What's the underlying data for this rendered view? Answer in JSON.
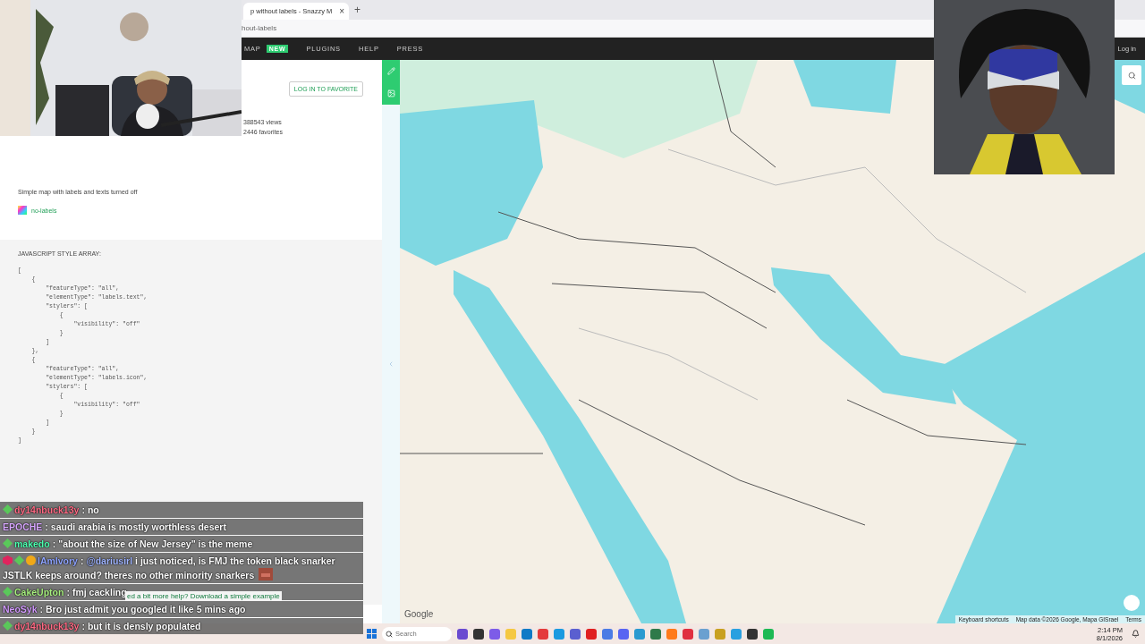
{
  "browser": {
    "tab_title": "p without labels - Snazzy M",
    "tab_close": "×",
    "new_tab": "+",
    "address": "hout-labels"
  },
  "nav": {
    "items": [
      {
        "label": "MAP",
        "badge": "NEW"
      },
      {
        "label": "PLUGINS"
      },
      {
        "label": "HELP"
      },
      {
        "label": "PRESS"
      }
    ],
    "login": "Log in"
  },
  "style_page": {
    "favorite_button": "LOG IN TO FAVORITE",
    "views": "388543 views",
    "favorites": "2446 favorites",
    "description": "Simple map with labels and texts turned off",
    "tag": "no-labels",
    "code_heading": "JAVASCRIPT STYLE ARRAY:",
    "code_lines": [
      "[",
      "    {",
      "        \"featureType\": \"all\",",
      "        \"elementType\": \"labels.text\",",
      "        \"stylers\": [",
      "            {",
      "                \"visibility\": \"off\"",
      "            }",
      "        ]",
      "    },",
      "    {",
      "        \"featureType\": \"all\",",
      "        \"elementType\": \"labels.icon\",",
      "        \"stylers\": [",
      "            {",
      "                \"visibility\": \"off\"",
      "            }",
      "        ]",
      "    }",
      "]"
    ],
    "help_text": "ed a bit more help? Download a simple example"
  },
  "map": {
    "logo": "Google",
    "attribution": [
      "Keyboard shortcuts",
      "Map data ©2026 Google, Mapa GISrael",
      "Terms"
    ]
  },
  "chat": [
    {
      "user": "dy14nbuck13y",
      "color": "#ff6b85",
      "separator": ":",
      "text": "no",
      "emote": false
    },
    {
      "user": "EPOCHE",
      "color": "#d9a8ff",
      "separator": ":",
      "text": "saudi arabia is mostly worthless desert",
      "emote": false
    },
    {
      "user": "makedo",
      "color": "#4dffb0",
      "separator": ":",
      "text": "\"about the size of New Jersey\" is the meme",
      "emote": false
    },
    {
      "user": "IAmIvory",
      "color": "#8fa4ff",
      "separator": ":",
      "mention": "@dariusirl",
      "text": "i just noticed, is FMJ the token black snarker",
      "text_2": "JSTLK keeps around? theres no other minority snarkers",
      "emote": true
    },
    {
      "user": "CakeUpton",
      "color": "#a8f080",
      "separator": ":",
      "text": "fmj cackling",
      "emote": false
    },
    {
      "user": "NeoSyk",
      "color": "#d49cff",
      "separator": ":",
      "text": "Bro just admit you googled it like 5 mins ago",
      "emote": false
    },
    {
      "user": "dy14nbuck13y",
      "color": "#ff6b85",
      "separator": ":",
      "text": "but it is densly populated",
      "emote": false
    }
  ],
  "taskbar": {
    "search_placeholder": "Search",
    "time": "2:14 PM",
    "date": "8/1/2026"
  }
}
